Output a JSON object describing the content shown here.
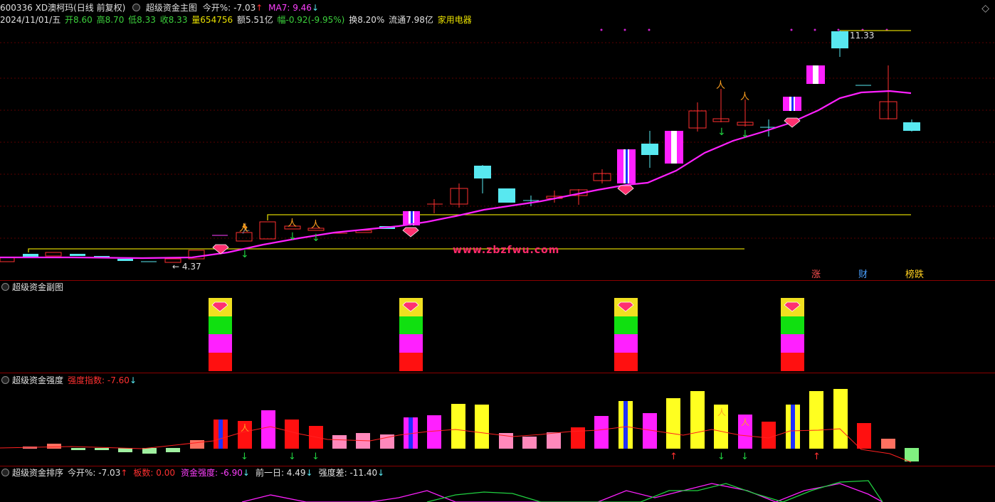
{
  "header": {
    "code_name": "600336 XD澳柯玛(日线 前复权)",
    "indicator": "超级资金主图",
    "today_open_label": "今开%:",
    "today_open_value": "-7.03",
    "ma_label": "MA7: 9.46",
    "date": "2024/11/01/五",
    "open": "开8.60",
    "high": "高8.70",
    "low": "低8.33",
    "close": "收8.33",
    "volume": "量654756",
    "amount": "额5.51亿",
    "change": "幅-0.92(-9.95%)",
    "turnover": "换8.20%",
    "float": "流通7.98亿",
    "industry": "家用电器"
  },
  "main_chart": {
    "high_label": "11.33",
    "low_label": "← 4.37",
    "watermark": "www.zbzfwu.com",
    "badges": [
      "涨",
      "财",
      "榜跌"
    ],
    "colors": {
      "up": "#ff3030",
      "down": "#58e8f0",
      "ma": "#ff20ff",
      "level": "#e8e000"
    }
  },
  "panel2": {
    "title": "超级资金副图"
  },
  "panel3": {
    "title": "超级资金强度",
    "param_label": "强度指数: -7.60"
  },
  "panel4": {
    "title": "超级资金排序",
    "open_label": "今开%: -7.03",
    "board_label": "板数: 0.00",
    "strength_label": "资金强度: -6.90",
    "prev_label": "前一日: 4.49",
    "diff_label": "强度差: -11.40"
  },
  "icons": [
    "settings-dot-icon",
    "close-icon",
    "arrow-up-icon",
    "arrow-down-icon",
    "gem-icon",
    "runner-icon"
  ]
}
